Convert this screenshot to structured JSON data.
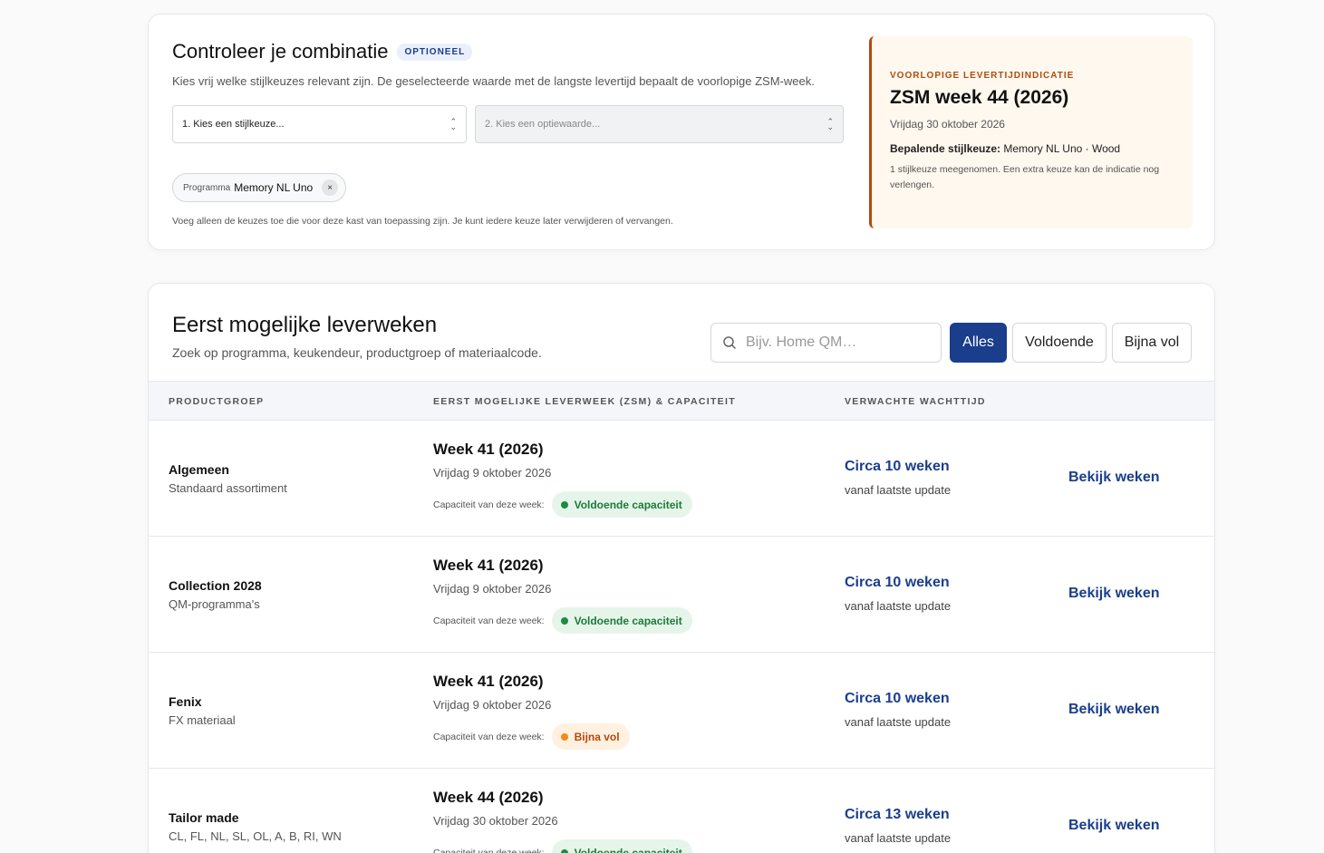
{
  "combo": {
    "title": "Controleer je combinatie",
    "badge": "OPTIONEEL",
    "description": "Kies vrij welke stijlkeuzes relevant zijn. De geselecteerde waarde met de langste levertijd bepaalt de voorlopige ZSM-week.",
    "select_style": "1. Kies een stijlkeuze...",
    "select_option": "2. Kies een optiewaarde...",
    "chip_key": "Programma",
    "chip_value": "Memory NL Uno",
    "chip_remove": "×",
    "note": "Voeg alleen de keuzes toe die voor deze kast van toepassing zijn. Je kunt iedere keuze later verwijderen of vervangen."
  },
  "indication": {
    "label": "VOORLOPIGE LEVERTIJDINDICATIE",
    "week": "ZSM week 44 (2026)",
    "date": "Vrijdag 30 oktober 2026",
    "det_label": "Bepalende stijlkeuze:",
    "det_value": "Memory NL Uno · Wood",
    "note": "1 stijlkeuze meegenomen. Een extra keuze kan de indicatie nog verlengen.",
    "accent": "#b34a0c",
    "bg": "#fef8ee"
  },
  "weeks": {
    "title": "Eerst mogelijke leverweken",
    "description": "Zoek op programma, keukendeur, productgroep of materiaalcode.",
    "search_placeholder": "Bijv. Home QM…",
    "filters": [
      "Alles",
      "Voldoende",
      "Bijna vol"
    ],
    "active_filter": "Alles",
    "headers": [
      "PRODUCTGROEP",
      "EERST MOGELIJKE LEVERWEEK (ZSM) & CAPACITEIT",
      "VERWACHTE WACHTTIJD"
    ],
    "cap_label": "Capaciteit van deze week:",
    "rows": [
      {
        "name": "Algemeen",
        "sub": "Standaard assortiment",
        "week": "Week 41 (2026)",
        "date": "Vrijdag 9 oktober 2026",
        "cap": "Voldoende capaciteit",
        "status": "ok",
        "wait": "Circa 10 weken",
        "wait_sub": "vanaf laatste update",
        "action": "Bekijk weken"
      },
      {
        "name": "Collection 2028",
        "sub": "QM-programma's",
        "week": "Week 41 (2026)",
        "date": "Vrijdag 9 oktober 2026",
        "cap": "Voldoende capaciteit",
        "status": "ok",
        "wait": "Circa 10 weken",
        "wait_sub": "vanaf laatste update",
        "action": "Bekijk weken"
      },
      {
        "name": "Fenix",
        "sub": "FX materiaal",
        "week": "Week 41 (2026)",
        "date": "Vrijdag 9 oktober 2026",
        "cap": "Bijna vol",
        "status": "warn",
        "wait": "Circa 10 weken",
        "wait_sub": "vanaf laatste update",
        "action": "Bekijk weken"
      },
      {
        "name": "Tailor made",
        "sub": "CL, FL, NL, SL, OL, A, B, RI, WN",
        "week": "Week 44 (2026)",
        "date": "Vrijdag 30 oktober 2026",
        "cap": "Voldoende capaciteit",
        "status": "ok",
        "wait": "Circa 13 weken",
        "wait_sub": "vanaf laatste update",
        "action": "Bekijk weken"
      }
    ]
  },
  "colors": {
    "brand": "#1a3e8c",
    "ok_bg": "#e6f5ea",
    "ok_text": "#1e7a3a",
    "ok_dot": "#1e8a42",
    "warn_bg": "#fff0e0",
    "warn_text": "#b34a0c",
    "warn_dot": "#f08a1c"
  }
}
